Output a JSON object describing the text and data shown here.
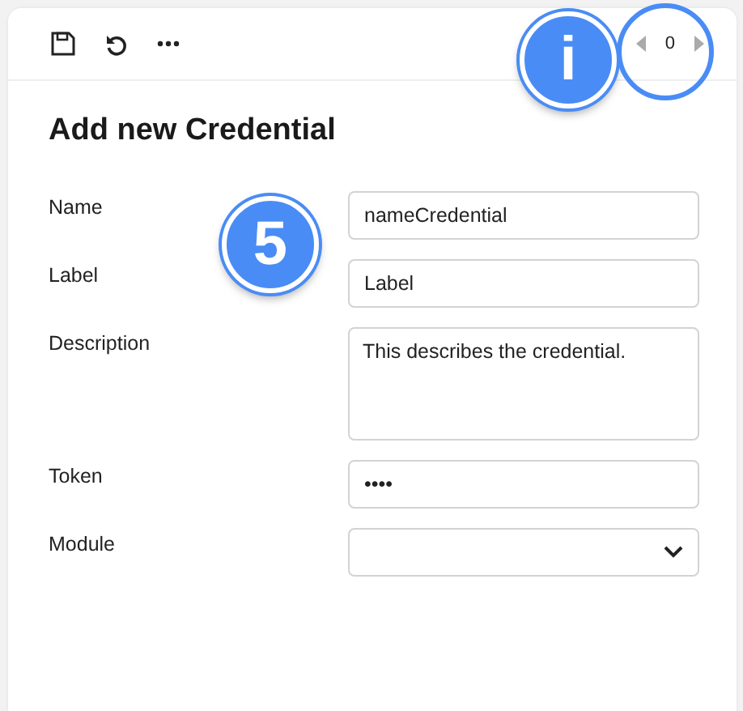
{
  "toolbar": {
    "buttons": [
      {
        "kind": "save"
      },
      {
        "kind": "undo"
      },
      {
        "kind": "more"
      }
    ],
    "callout": {
      "text": "i"
    },
    "pager": {
      "value": "0",
      "highlighted": true
    }
  },
  "title": "Add new Credential",
  "fields": [
    {
      "label": "Name",
      "kind": "text",
      "value": "nameCredential"
    },
    {
      "label": "Label",
      "kind": "text",
      "value": "Label"
    },
    {
      "label": "Description",
      "kind": "textarea",
      "value": "This describes the credential."
    },
    {
      "label": "Token",
      "kind": "text",
      "value": "••••"
    },
    {
      "label": "Module",
      "kind": "select"
    }
  ],
  "step_marker": {
    "text": "5"
  }
}
